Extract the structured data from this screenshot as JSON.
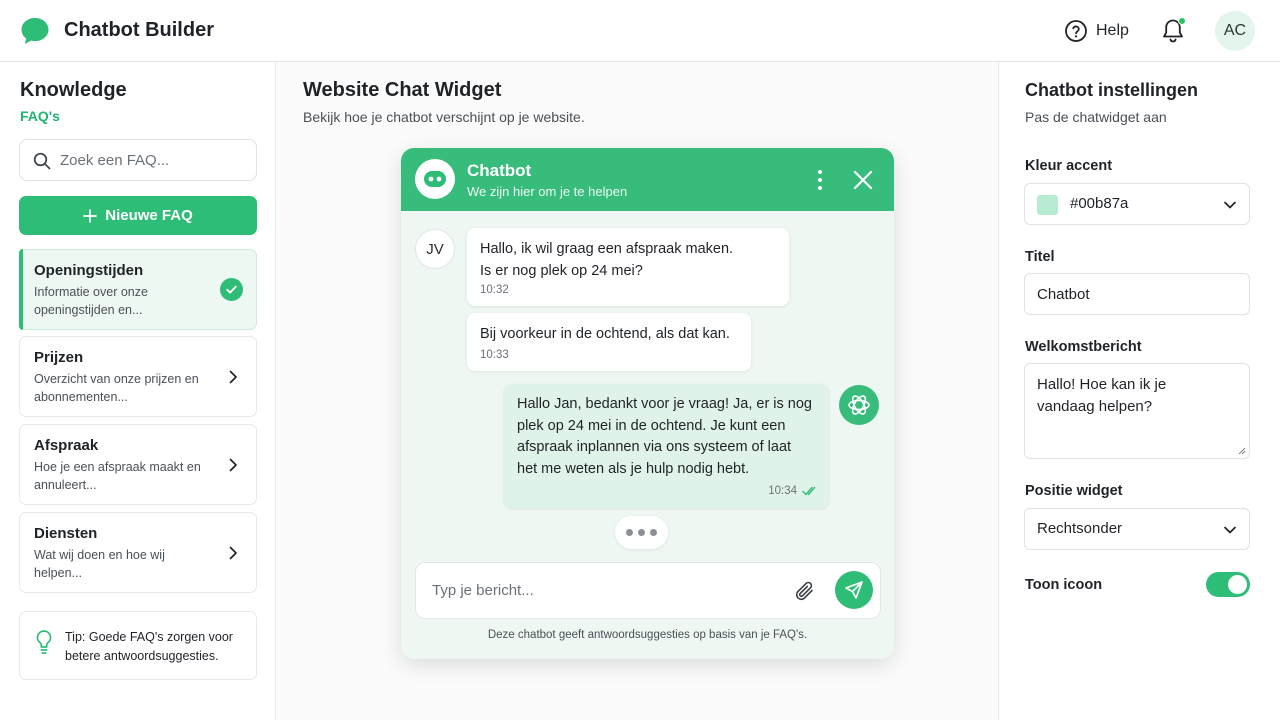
{
  "app": {
    "title": "Chatbot Builder",
    "help_label": "Help",
    "avatar_initials": "AC",
    "accent": "#2ebd77"
  },
  "sidebar": {
    "title": "Knowledge",
    "subtitle": "FAQ's",
    "search_placeholder": "Zoek een FAQ...",
    "new_button_label": "Nieuwe FAQ",
    "items": [
      {
        "title": "Openingstijden",
        "description": "Informatie over onze openingstijden en...",
        "active": true,
        "icon": "check-circle-icon"
      },
      {
        "title": "Prijzen",
        "description": "Overzicht van onze prijzen en abonnementen...",
        "active": false,
        "icon": "chevron-right-icon"
      },
      {
        "title": "Afspraak",
        "description": "Hoe je een afspraak maakt en annuleert...",
        "active": false,
        "icon": "chevron-right-icon"
      },
      {
        "title": "Diensten",
        "description": "Wat wij doen en hoe wij helpen...",
        "active": false,
        "icon": "chevron-right-icon"
      }
    ],
    "tip": "Tip: Goede FAQ's zorgen voor betere antwoordsuggesties."
  },
  "main": {
    "title": "Website Chat Widget",
    "subtitle": "Bekijk hoe je chatbot verschijnt op je website."
  },
  "widget": {
    "title": "Chatbot",
    "subtitle": "We zijn hier om je te helpen",
    "user_initials": "JV",
    "messages": [
      {
        "from": "user",
        "text": "Hallo, ik wil graag een afspraak maken.\nIs er nog plek op 24 mei?",
        "time": "10:32"
      },
      {
        "from": "user",
        "text": "Bij voorkeur in de ochtend, als dat kan.",
        "time": "10:33"
      },
      {
        "from": "bot",
        "text": "Hallo Jan, bedankt voor je vraag! Ja, er is nog\nplek op 24 mei in de ochtend. Je kunt een\nafspraak inplannen via ons systeem of laat\nhet me weten als je hulp nodig hebt.",
        "time": "10:34"
      }
    ],
    "input_placeholder": "Typ je bericht...",
    "footer": "Deze chatbot geeft antwoordsuggesties op basis van je FAQ's."
  },
  "settings": {
    "title": "Chatbot instellingen",
    "subtitle": "Pas de chatwidget aan",
    "accent_label": "Kleur accent",
    "accent_value": "#00b87a",
    "title_label": "Titel",
    "title_value": "Chatbot",
    "welcome_label": "Welkomstbericht",
    "welcome_value": "Hallo! Hoe kan ik je vandaag helpen?",
    "position_label": "Positie widget",
    "position_value": "Rechtsonder",
    "show_icon_label": "Toon icoon",
    "show_icon": true
  }
}
